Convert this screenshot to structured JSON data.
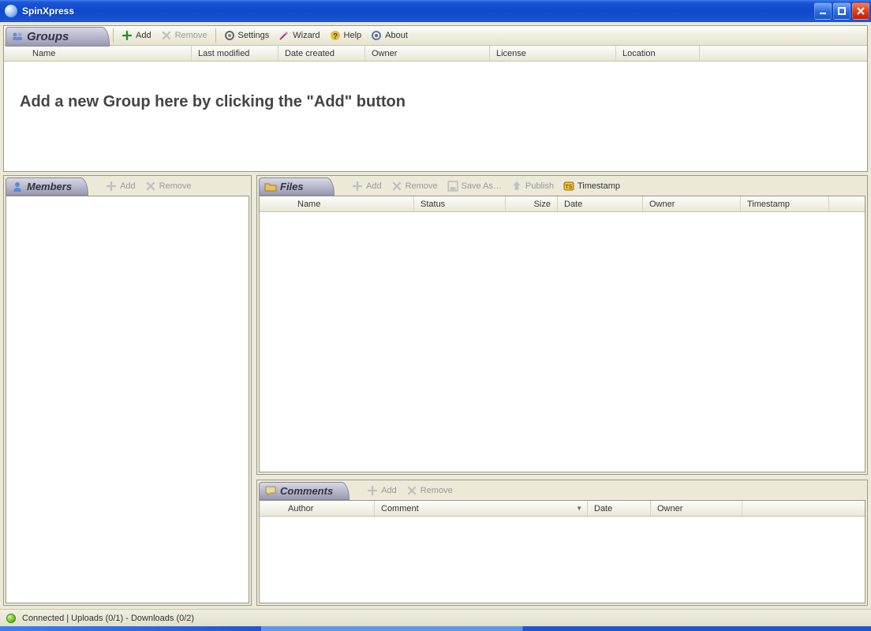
{
  "app": {
    "title": "SpinXpress"
  },
  "groups": {
    "tab_label": "Groups",
    "toolbar": {
      "add": "Add",
      "remove": "Remove",
      "settings": "Settings",
      "wizard": "Wizard",
      "help": "Help",
      "about": "About"
    },
    "columns": {
      "name": "Name",
      "last_modified": "Last modified",
      "date_created": "Date created",
      "owner": "Owner",
      "license": "License",
      "location": "Location"
    },
    "empty_message": "Add a new Group here by clicking the \"Add\" button"
  },
  "members": {
    "tab_label": "Members",
    "toolbar": {
      "add": "Add",
      "remove": "Remove"
    }
  },
  "files": {
    "tab_label": "Files",
    "toolbar": {
      "add": "Add",
      "remove": "Remove",
      "save_as": "Save As…",
      "publish": "Publish",
      "timestamp": "Timestamp"
    },
    "columns": {
      "name": "Name",
      "status": "Status",
      "size": "Size",
      "date": "Date",
      "owner": "Owner",
      "timestamp": "Timestamp"
    }
  },
  "comments": {
    "tab_label": "Comments",
    "toolbar": {
      "add": "Add",
      "remove": "Remove"
    },
    "columns": {
      "author": "Author",
      "comment": "Comment",
      "date": "Date",
      "owner": "Owner"
    }
  },
  "status": {
    "text": "Connected  |  Uploads (0/1) - Downloads (0/2)"
  }
}
